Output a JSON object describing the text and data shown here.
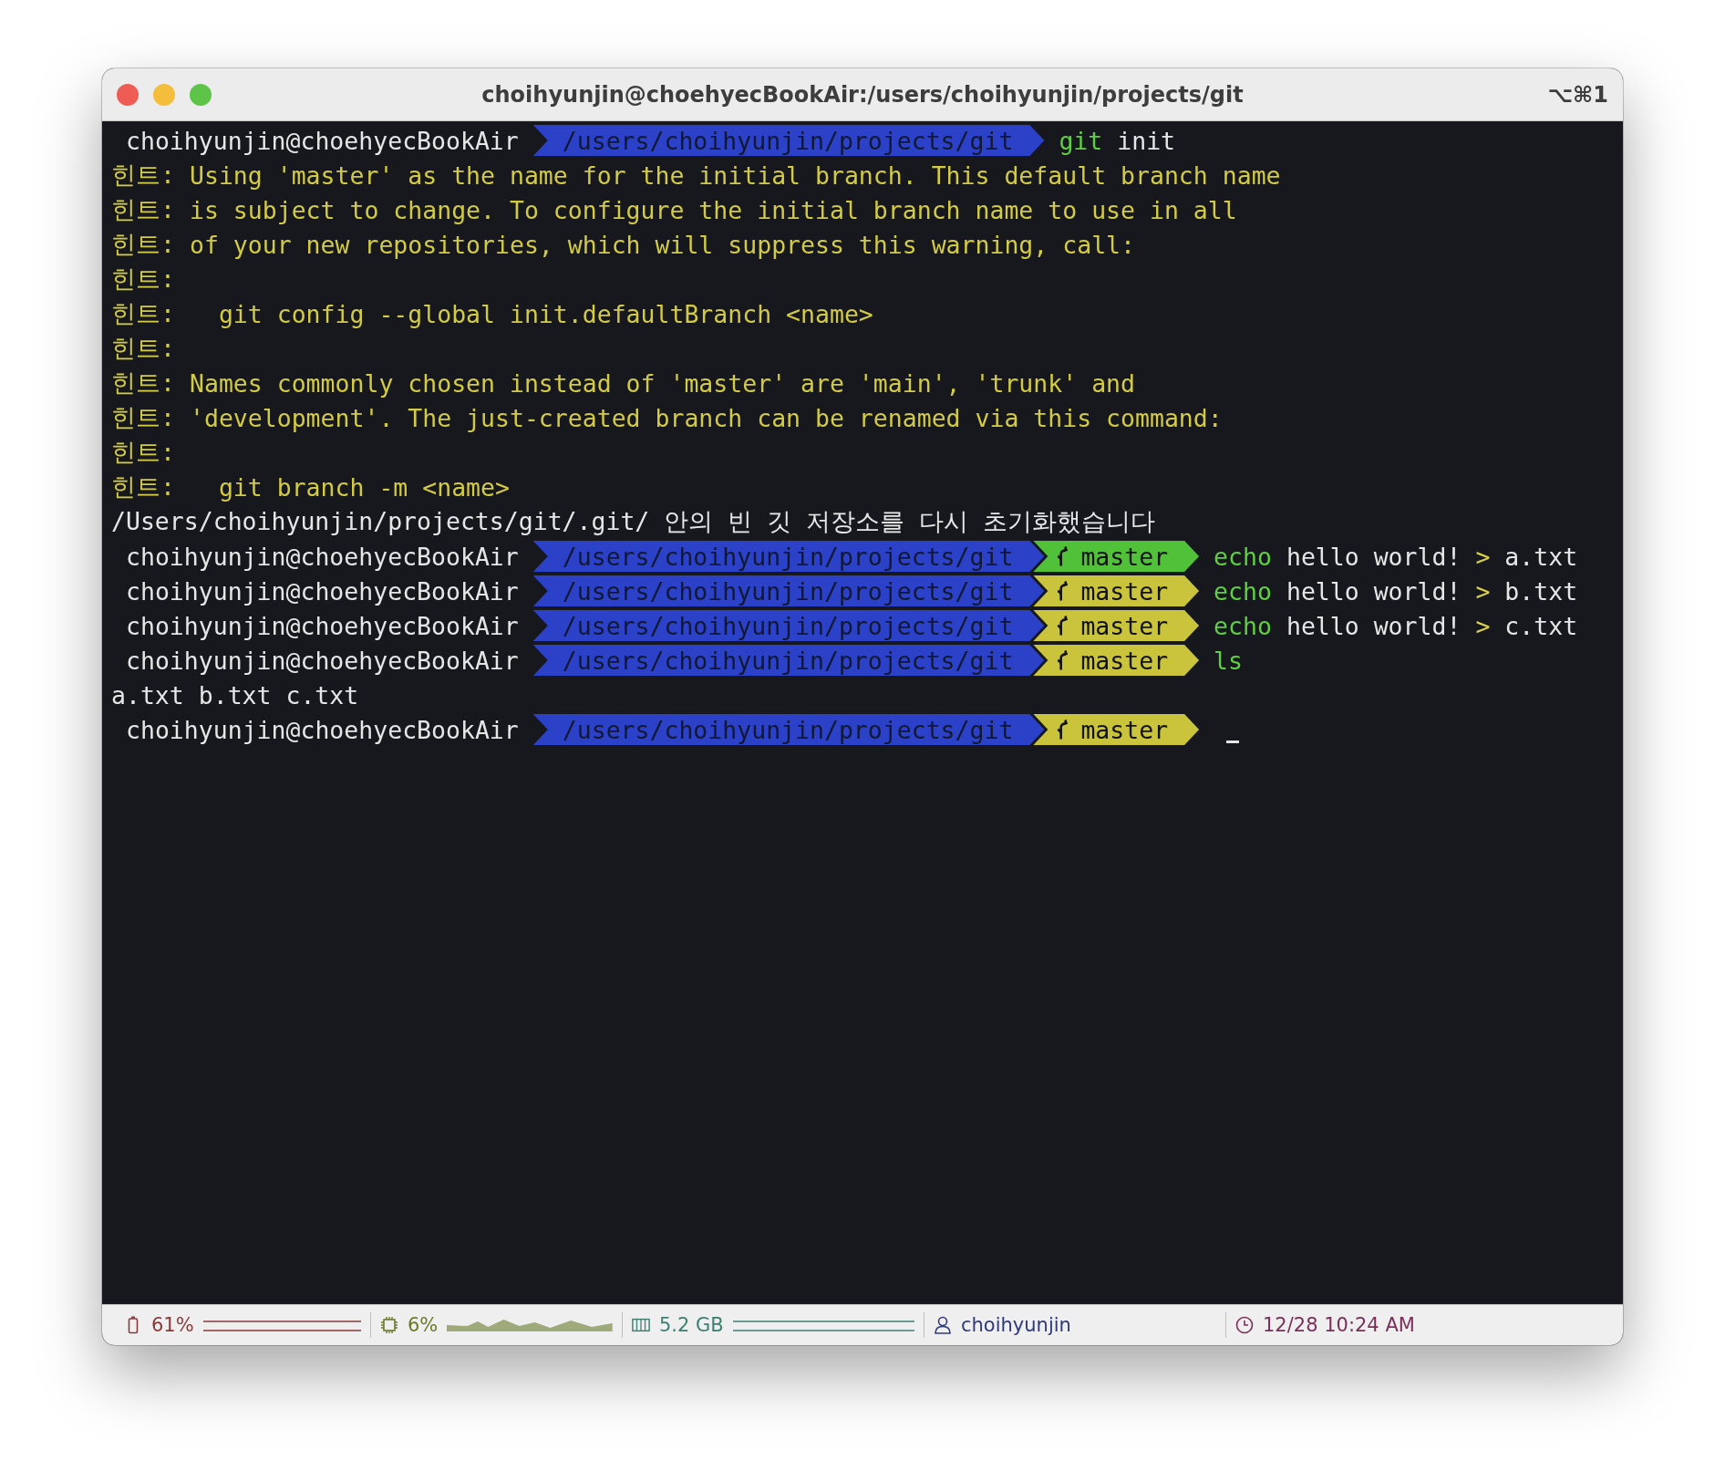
{
  "window": {
    "title": "choihyunjin@choehyecBookAir:/users/choihyunjin/projects/git",
    "shortcut": "⌥⌘1"
  },
  "terminal": {
    "lines": [
      {
        "kind": "prompt",
        "user": "choihyunjin@choehyecBookAir",
        "path": "/users/choihyunjin/projects/git",
        "command": [
          {
            "kind": "command",
            "text": "git"
          },
          {
            "kind": "arg",
            "text": "init"
          }
        ]
      },
      {
        "kind": "hint",
        "label": "힌트:",
        "text": "Using 'master' as the name for the initial branch. This default branch name"
      },
      {
        "kind": "hint",
        "label": "힌트:",
        "text": "is subject to change. To configure the initial branch name to use in all"
      },
      {
        "kind": "hint",
        "label": "힌트:",
        "text": "of your new repositories, which will suppress this warning, call:"
      },
      {
        "kind": "hint",
        "label": "힌트:"
      },
      {
        "kind": "hint",
        "label": "힌트:",
        "text": "  git config --global init.defaultBranch <name>"
      },
      {
        "kind": "hint",
        "label": "힌트:"
      },
      {
        "kind": "hint",
        "label": "힌트:",
        "text": "Names commonly chosen instead of 'master' are 'main', 'trunk' and"
      },
      {
        "kind": "hint",
        "label": "힌트:",
        "text": "'development'. The just-created branch can be renamed via this command:"
      },
      {
        "kind": "hint",
        "label": "힌트:"
      },
      {
        "kind": "hint",
        "label": "힌트:",
        "text": "  git branch -m <name>"
      },
      {
        "kind": "output",
        "text": "/Users/choihyunjin/projects/git/.git/ 안의 빈 깃 저장소를 다시 초기화했습니다"
      },
      {
        "kind": "prompt",
        "user": "choihyunjin@choehyecBookAir",
        "path": "/users/choihyunjin/projects/git",
        "git": {
          "branch": "master",
          "dirty": false
        },
        "command": [
          {
            "kind": "command",
            "text": "echo"
          },
          {
            "kind": "arg",
            "text": "hello world!"
          },
          {
            "kind": "operator",
            "text": ">"
          },
          {
            "kind": "arg",
            "text": "a.txt"
          }
        ]
      },
      {
        "kind": "prompt",
        "user": "choihyunjin@choehyecBookAir",
        "path": "/users/choihyunjin/projects/git",
        "git": {
          "branch": "master",
          "dirty": true
        },
        "command": [
          {
            "kind": "command",
            "text": "echo"
          },
          {
            "kind": "arg",
            "text": "hello world!"
          },
          {
            "kind": "operator",
            "text": ">"
          },
          {
            "kind": "arg",
            "text": "b.txt"
          }
        ]
      },
      {
        "kind": "prompt",
        "user": "choihyunjin@choehyecBookAir",
        "path": "/users/choihyunjin/projects/git",
        "git": {
          "branch": "master",
          "dirty": true
        },
        "command": [
          {
            "kind": "command",
            "text": "echo"
          },
          {
            "kind": "arg",
            "text": "hello world!"
          },
          {
            "kind": "operator",
            "text": ">"
          },
          {
            "kind": "arg",
            "text": "c.txt"
          }
        ]
      },
      {
        "kind": "prompt",
        "user": "choihyunjin@choehyecBookAir",
        "path": "/users/choihyunjin/projects/git",
        "git": {
          "branch": "master",
          "dirty": true
        },
        "command": [
          {
            "kind": "command",
            "text": "ls"
          }
        ]
      },
      {
        "kind": "output",
        "text": "a.txt b.txt c.txt"
      },
      {
        "kind": "prompt",
        "user": "choihyunjin@choehyecBookAir",
        "path": "/users/choihyunjin/projects/git",
        "git": {
          "branch": "master",
          "dirty": true
        },
        "cursor": true
      }
    ]
  },
  "status_bar": {
    "items": [
      {
        "kind": "battery",
        "text": "61%",
        "color": "#8b3a3a"
      },
      {
        "kind": "cpu",
        "text": "6%",
        "color": "#6b7a2a"
      },
      {
        "kind": "memory",
        "text": "5.2 GB",
        "color": "#3f7f72"
      },
      {
        "kind": "user",
        "text": "choihyunjin",
        "color": "#2f3a7a"
      },
      {
        "kind": "clock",
        "text": "12/28 10:24 AM",
        "color": "#7a2f5a"
      }
    ]
  }
}
